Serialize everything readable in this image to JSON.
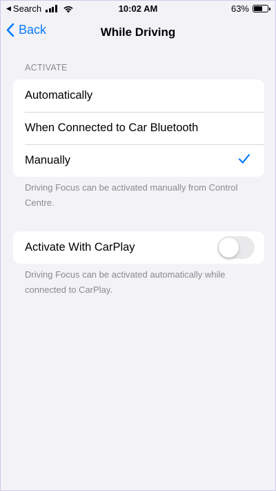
{
  "status_bar": {
    "back_app": "Search",
    "time": "10:02 AM",
    "battery_text": "63%",
    "battery_level": 0.63
  },
  "nav": {
    "back_label": "Back",
    "title": "While Driving"
  },
  "activate_section": {
    "header": "ACTIVATE",
    "options": [
      {
        "label": "Automatically",
        "selected": false
      },
      {
        "label": "When Connected to Car Bluetooth",
        "selected": false
      },
      {
        "label": "Manually",
        "selected": true
      }
    ],
    "footnote": "Driving Focus can be activated manually from Control Centre."
  },
  "carplay_section": {
    "label": "Activate With CarPlay",
    "enabled": false,
    "footnote": "Driving Focus can be activated automatically while connected to CarPlay."
  },
  "colors": {
    "accent": "#0a7aff",
    "background": "#f2f2f7",
    "secondary_text": "#8a8a8e",
    "toggle_off": "#e9e9eb"
  },
  "icons": {
    "back": "chevron-left-icon",
    "selected": "checkmark-icon",
    "wifi": "wifi-icon",
    "signal": "cellular-signal-icon",
    "battery": "battery-icon"
  }
}
